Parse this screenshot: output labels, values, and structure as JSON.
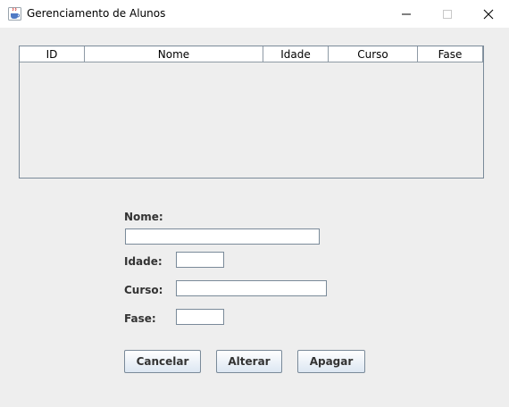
{
  "window": {
    "title": "Gerenciamento de Alunos",
    "icons": {
      "app": "java-icon",
      "minimize": "minimize-icon",
      "maximize": "maximize-icon",
      "close": "close-icon"
    }
  },
  "table": {
    "columns": [
      "ID",
      "Nome",
      "Idade",
      "Curso",
      "Fase"
    ],
    "rows": []
  },
  "form": {
    "nome_label": "Nome:",
    "nome_value": "",
    "idade_label": "Idade:",
    "idade_value": "",
    "curso_label": "Curso:",
    "curso_value": "",
    "fase_label": "Fase:",
    "fase_value": ""
  },
  "buttons": {
    "cancelar": "Cancelar",
    "alterar": "Alterar",
    "apagar": "Apagar"
  },
  "colors": {
    "background": "#eeeeee",
    "border": "#7a8a99"
  }
}
